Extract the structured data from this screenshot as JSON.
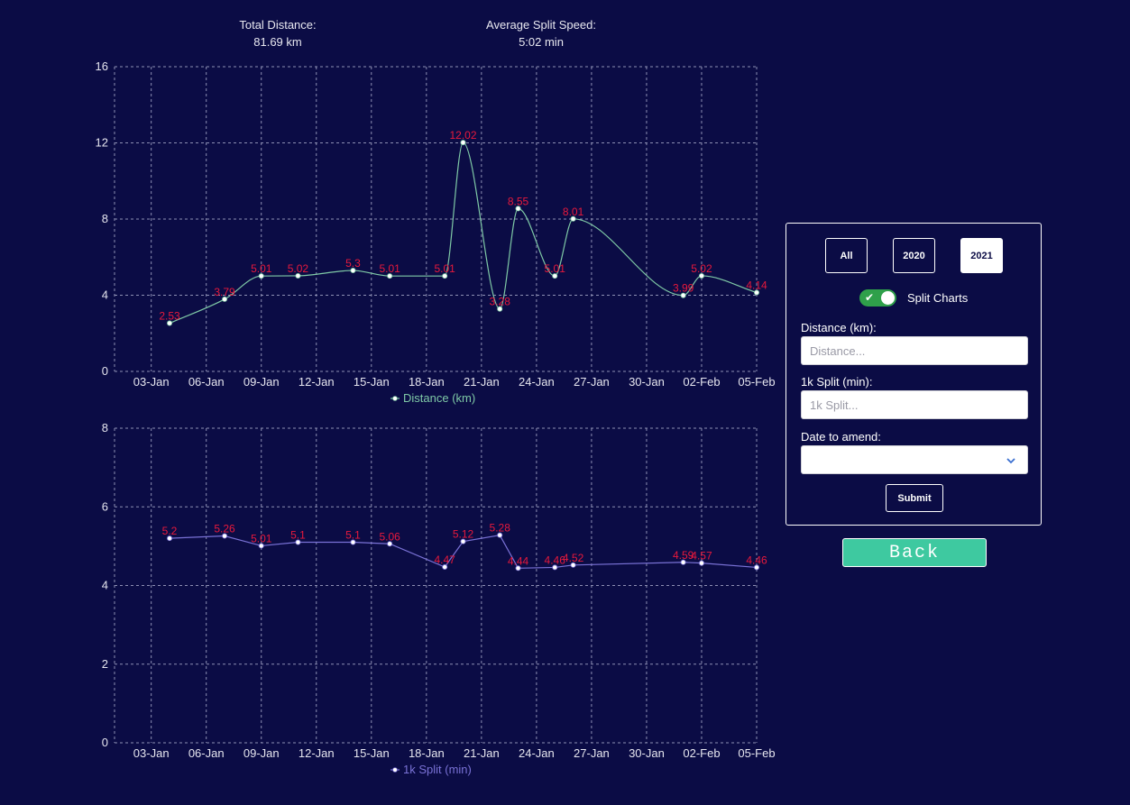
{
  "summary": {
    "total_distance_label": "Total Distance:",
    "total_distance_value": "81.69 km",
    "avg_split_label": "Average Split Speed:",
    "avg_split_value": "5:02 min"
  },
  "chart_data": [
    {
      "type": "line",
      "x": [
        "2021-01-04",
        "2021-01-07",
        "2021-01-09",
        "2021-01-11",
        "2021-01-14",
        "2021-01-16",
        "2021-01-19",
        "2021-01-20",
        "2021-01-22",
        "2021-01-23",
        "2021-01-25",
        "2021-01-26",
        "2021-02-01",
        "2021-02-02",
        "2021-02-05"
      ],
      "series": [
        {
          "name": "Distance (km)",
          "labels": [
            "2.53",
            "3.79",
            "5.01",
            "5.02",
            "5.3",
            "5.01",
            "5.01",
            "12.02",
            "3.28",
            "8.55",
            "5.01",
            "8.01",
            "3.99",
            "5.02",
            "4.14"
          ],
          "values": [
            2.53,
            3.79,
            5.01,
            5.02,
            5.3,
            5.01,
            5.01,
            12.02,
            3.28,
            8.55,
            5.01,
            8.01,
            3.99,
            5.02,
            4.14
          ]
        }
      ],
      "xticks": [
        "03-Jan",
        "06-Jan",
        "09-Jan",
        "12-Jan",
        "15-Jan",
        "18-Jan",
        "21-Jan",
        "24-Jan",
        "27-Jan",
        "30-Jan",
        "02-Feb",
        "05-Feb"
      ],
      "yticks": [
        "0",
        "4",
        "8",
        "12",
        "16"
      ],
      "xlim": [
        "2021-01-01",
        "2021-02-05"
      ],
      "ylim": [
        0,
        16
      ],
      "grid": true,
      "curve": "smooth",
      "legend": "bottom",
      "color": "#7fc9a6"
    },
    {
      "type": "line",
      "x": [
        "2021-01-04",
        "2021-01-07",
        "2021-01-09",
        "2021-01-11",
        "2021-01-14",
        "2021-01-16",
        "2021-01-19",
        "2021-01-20",
        "2021-01-22",
        "2021-01-23",
        "2021-01-25",
        "2021-01-26",
        "2021-02-01",
        "2021-02-02",
        "2021-02-05"
      ],
      "series": [
        {
          "name": "1k Split (min)",
          "labels": [
            "5.2",
            "5.26",
            "5.01",
            "5.1",
            "5.1",
            "5.06",
            "4.47",
            "5.12",
            "5.28",
            "4.44",
            "4.46",
            "4.52",
            "4.59",
            "4.57",
            "4.46"
          ],
          "values": [
            5.2,
            5.26,
            5.01,
            5.1,
            5.1,
            5.06,
            4.47,
            5.12,
            5.28,
            4.44,
            4.46,
            4.52,
            4.59,
            4.57,
            4.46
          ]
        }
      ],
      "xticks": [
        "03-Jan",
        "06-Jan",
        "09-Jan",
        "12-Jan",
        "15-Jan",
        "18-Jan",
        "21-Jan",
        "24-Jan",
        "27-Jan",
        "30-Jan",
        "02-Feb",
        "05-Feb"
      ],
      "yticks": [
        "0",
        "2",
        "4",
        "6",
        "8"
      ],
      "xlim": [
        "2021-01-01",
        "2021-02-05"
      ],
      "ylim": [
        0,
        8
      ],
      "grid": true,
      "curve": "linear",
      "legend": "bottom",
      "color": "#7a72d6"
    }
  ],
  "colors": {
    "background": "#0b0c45",
    "data_label": "#e8193c",
    "toggle_on": "#2fa04a",
    "back_button": "#3ec9a0"
  },
  "panel": {
    "year_buttons": [
      {
        "label": "All",
        "active": false
      },
      {
        "label": "2020",
        "active": false
      },
      {
        "label": "2021",
        "active": true
      }
    ],
    "split_toggle": {
      "label": "Split Charts",
      "on": true
    },
    "distance": {
      "label": "Distance (km):",
      "placeholder": "Distance..."
    },
    "split": {
      "label": "1k Split (min):",
      "placeholder": "1k Split..."
    },
    "date": {
      "label": "Date to amend:",
      "value": ""
    },
    "submit_label": "Submit",
    "check_icon": "check-icon",
    "dropdown_icon": "chevron-down-icon"
  },
  "back_label": "Back"
}
